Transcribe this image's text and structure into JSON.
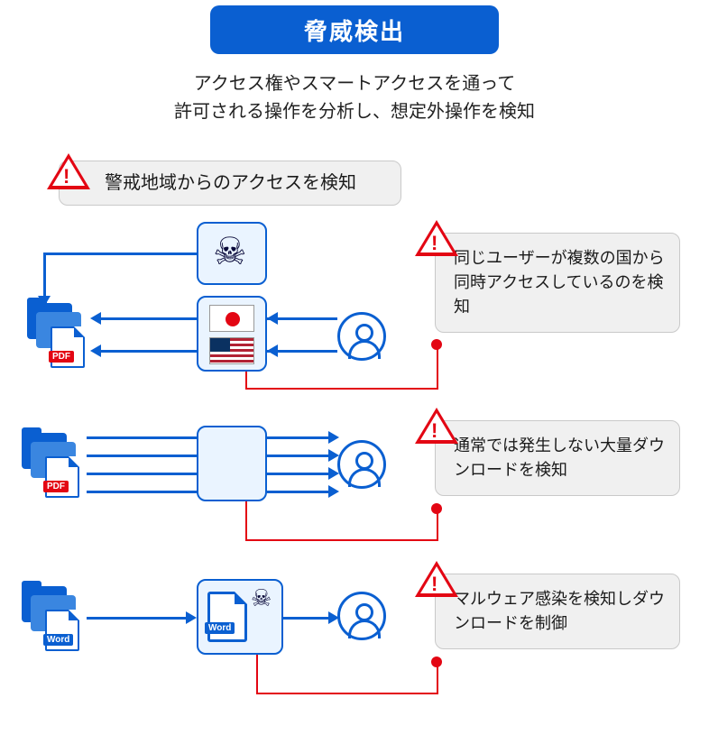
{
  "title": "脅威検出",
  "subtitle_line1": "アクセス権やスマートアクセスを通って",
  "subtitle_line2": "許可される操作を分析し、想定外操作を検知",
  "alerts": {
    "region": "警戒地域からのアクセスを検知",
    "multi_country": "同じユーザーが複数の国から同時アクセスしているのを検知",
    "bulk_download": "通常では発生しない大量ダウンロードを検知",
    "malware": "マルウェア感染を検知しダウンロードを制御"
  },
  "file_tags": {
    "pdf": "PDF",
    "word": "Word"
  },
  "icons": {
    "skull": "skull-crossbones",
    "user": "user",
    "flag_jp": "flag-japan",
    "flag_us": "flag-usa",
    "alert": "alert-triangle"
  },
  "colors": {
    "primary": "#0a5fd1",
    "alert": "#e30613",
    "box_bg": "#eaf4ff",
    "callout_bg": "#f0f0f0"
  }
}
